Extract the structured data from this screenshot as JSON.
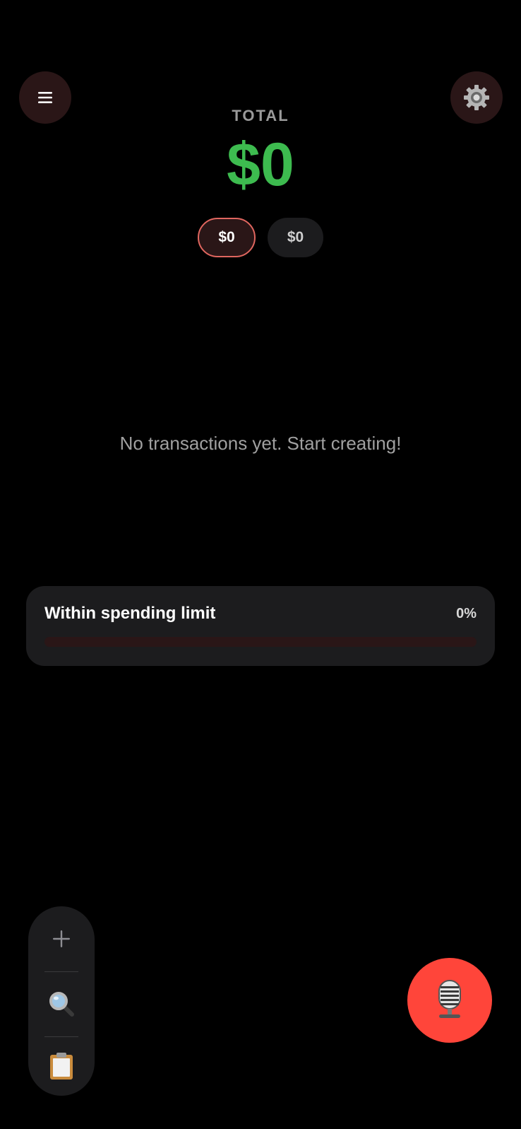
{
  "header": {
    "menu_icon": "hamburger-menu-icon",
    "settings_icon": "gear-icon"
  },
  "summary": {
    "total_label": "TOTAL",
    "total_amount": "$0",
    "total_color": "#3dbb4f"
  },
  "filters": [
    {
      "label": "$0",
      "selected": true
    },
    {
      "label": "$0",
      "selected": false
    }
  ],
  "empty_state": {
    "message": "No transactions yet. Start creating!"
  },
  "spending_limit": {
    "title": "Within spending limit",
    "percent_label": "0%",
    "progress": 0
  },
  "toolbar": {
    "items": [
      {
        "icon": "plus-icon"
      },
      {
        "icon": "magnifier-icon"
      },
      {
        "icon": "clipboard-icon"
      }
    ]
  },
  "mic_button": {
    "icon": "microphone-icon",
    "color": "#ff453a"
  }
}
